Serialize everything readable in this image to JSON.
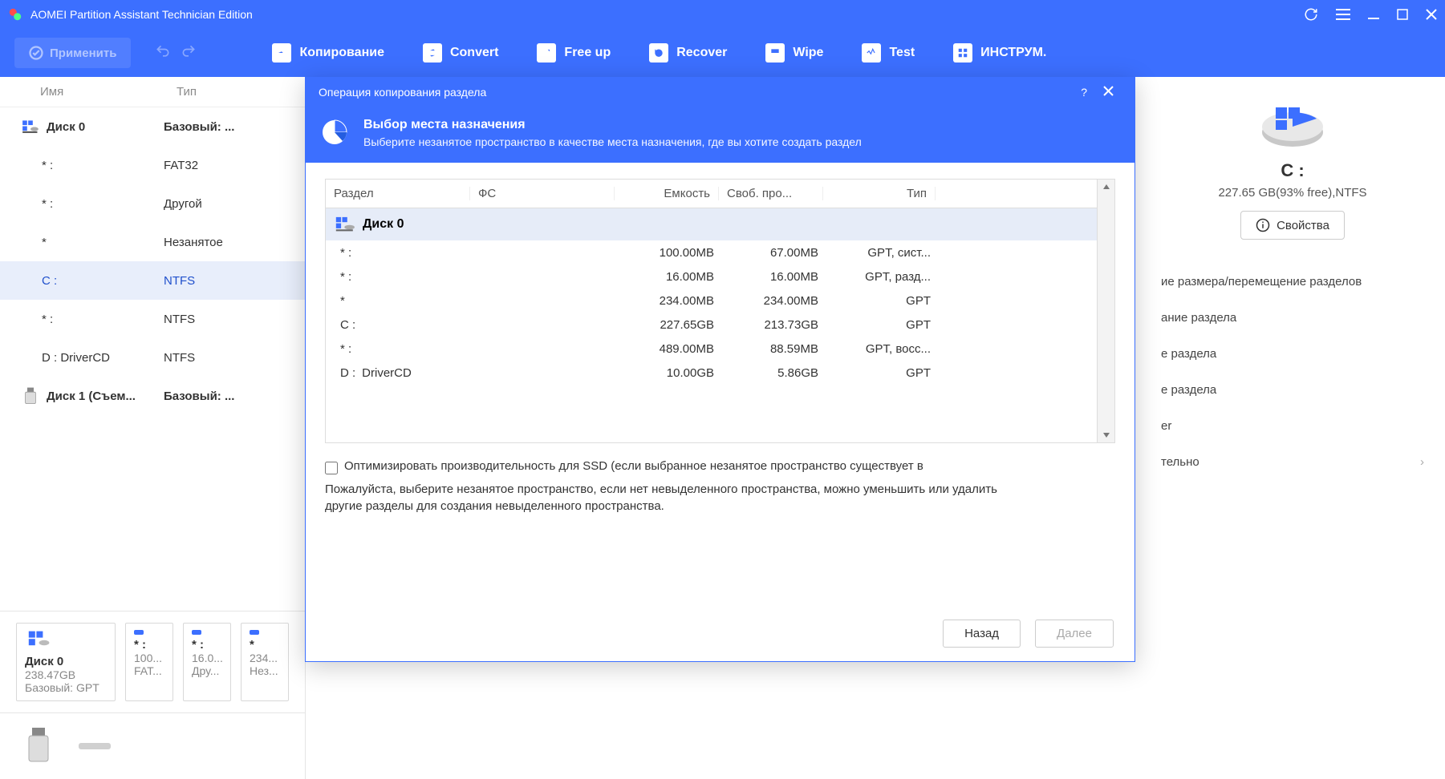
{
  "app": {
    "title": "AOMEI Partition Assistant Technician Edition"
  },
  "toolbar": {
    "apply": "Применить",
    "items": [
      "Копирование",
      "Convert",
      "Free up",
      "Recover",
      "Wipe",
      "Test",
      "ИНСТРУМ."
    ]
  },
  "columns": {
    "name": "Имя",
    "type": "Тип"
  },
  "disk_rows": [
    {
      "kind": "disk",
      "name": "Диск 0",
      "type": "Базовый: ..."
    },
    {
      "kind": "part",
      "name": "* :",
      "type": "FAT32"
    },
    {
      "kind": "part",
      "name": "* :",
      "type": "Другой"
    },
    {
      "kind": "part",
      "name": "*",
      "type": "Незанятое"
    },
    {
      "kind": "part",
      "name": "C :",
      "type": "NTFS",
      "selected": true
    },
    {
      "kind": "part",
      "name": "* :",
      "type": "NTFS"
    },
    {
      "kind": "part",
      "name": "D : DriverCD",
      "type": "NTFS"
    },
    {
      "kind": "disk",
      "name": "Диск 1 (Съем...",
      "type": "Базовый: ...",
      "usb": true
    }
  ],
  "cards": {
    "big": {
      "name": "Диск 0",
      "size": "238.47GB",
      "meta": "Базовый: GPT"
    },
    "small": [
      {
        "name": "* :",
        "size": "100...",
        "fs": "FAT..."
      },
      {
        "name": "* :",
        "size": "16.0...",
        "fs": "Дру..."
      },
      {
        "name": "*",
        "size": "234...",
        "fs": "Нез..."
      }
    ]
  },
  "right": {
    "letter": "C :",
    "meta": "227.65 GB(93% free),NTFS",
    "props": "Свойства",
    "actions": [
      "ие размера/перемещение разделов",
      "ание раздела",
      "е раздела",
      "е раздела",
      "er",
      "тельно"
    ]
  },
  "modal": {
    "title": "Операция копирования раздела",
    "sub_title": "Выбор места назначения",
    "sub_desc": "Выберите незанятое пространство в качестве места назначения, где вы хотите создать раздел",
    "headers": {
      "part": "Раздел",
      "fs": "ФС",
      "cap": "Емкость",
      "free": "Своб. про...",
      "type": "Тип"
    },
    "disk_label": "Диск 0",
    "rows": [
      {
        "part": "* :",
        "fs": "",
        "cap": "100.00MB",
        "free": "67.00MB",
        "type": "GPT, сист..."
      },
      {
        "part": "* :",
        "fs": "",
        "cap": "16.00MB",
        "free": "16.00MB",
        "type": "GPT, разд..."
      },
      {
        "part": "*",
        "fs": "",
        "cap": "234.00MB",
        "free": "234.00MB",
        "type": "GPT"
      },
      {
        "part": "C :",
        "fs": "",
        "cap": "227.65GB",
        "free": "213.73GB",
        "type": "GPT"
      },
      {
        "part": "* :",
        "fs": "",
        "cap": "489.00MB",
        "free": "88.59MB",
        "type": "GPT, восс..."
      },
      {
        "part": "D :",
        "fs": "DriverCD",
        "cap": "10.00GB",
        "free": "5.86GB",
        "type": "GPT"
      }
    ],
    "ssd_check": "Оптимизировать производительность для SSD (если выбранное незанятое пространство существует в",
    "note": "Пожалуйста, выберите незанятое пространство, если нет невыделенного пространства, можно уменьшить или удалить другие разделы для создания невыделенного пространства.",
    "back": "Назад",
    "next": "Далее"
  }
}
